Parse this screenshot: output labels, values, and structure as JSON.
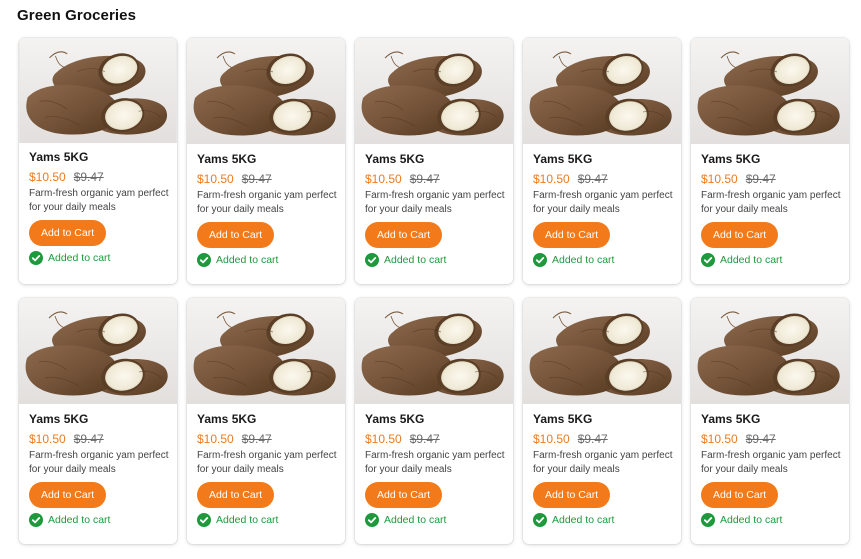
{
  "section": {
    "title": "Green Groceries"
  },
  "colors": {
    "accent": "#f27a1a",
    "price": "#f07a1c",
    "success": "#1e9a3c"
  },
  "products": [
    {
      "name": "Yams 5KG",
      "price": "$10.50",
      "old_price": "$9.47",
      "description": "Farm-fresh organic yam perfect for your daily meals",
      "button_label": "Add to Cart",
      "status": "Added to cart",
      "status_icon": "check-circle-icon"
    },
    {
      "name": "Yams 5KG",
      "price": "$10.50",
      "old_price": "$9.47",
      "description": "Farm-fresh organic yam perfect for your daily meals",
      "button_label": "Add to Cart",
      "status": "Added to cart",
      "status_icon": "check-circle-icon"
    },
    {
      "name": "Yams 5KG",
      "price": "$10.50",
      "old_price": "$9.47",
      "description": "Farm-fresh organic yam perfect for your daily meals",
      "button_label": "Add to Cart",
      "status": "Added to cart",
      "status_icon": "check-circle-icon"
    },
    {
      "name": "Yams 5KG",
      "price": "$10.50",
      "old_price": "$9.47",
      "description": "Farm-fresh organic yam perfect for your daily meals",
      "button_label": "Add to Cart",
      "status": "Added to cart",
      "status_icon": "check-circle-icon"
    },
    {
      "name": "Yams 5KG",
      "price": "$10.50",
      "old_price": "$9.47",
      "description": "Farm-fresh organic yam perfect for your daily meals",
      "button_label": "Add to Cart",
      "status": "Added to cart",
      "status_icon": "check-circle-icon"
    },
    {
      "name": "Yams 5KG",
      "price": "$10.50",
      "old_price": "$9.47",
      "description": "Farm-fresh organic yam perfect for your daily meals",
      "button_label": "Add to Cart",
      "status": "Added to cart",
      "status_icon": "check-circle-icon"
    },
    {
      "name": "Yams 5KG",
      "price": "$10.50",
      "old_price": "$9.47",
      "description": "Farm-fresh organic yam perfect for your daily meals",
      "button_label": "Add to Cart",
      "status": "Added to cart",
      "status_icon": "check-circle-icon"
    },
    {
      "name": "Yams 5KG",
      "price": "$10.50",
      "old_price": "$9.47",
      "description": "Farm-fresh organic yam perfect for your daily meals",
      "button_label": "Add to Cart",
      "status": "Added to cart",
      "status_icon": "check-circle-icon"
    },
    {
      "name": "Yams 5KG",
      "price": "$10.50",
      "old_price": "$9.47",
      "description": "Farm-fresh organic yam perfect for your daily meals",
      "button_label": "Add to Cart",
      "status": "Added to cart",
      "status_icon": "check-circle-icon"
    },
    {
      "name": "Yams 5KG",
      "price": "$10.50",
      "old_price": "$9.47",
      "description": "Farm-fresh organic yam perfect for your daily meals",
      "button_label": "Add to Cart",
      "status": "Added to cart",
      "status_icon": "check-circle-icon"
    }
  ]
}
